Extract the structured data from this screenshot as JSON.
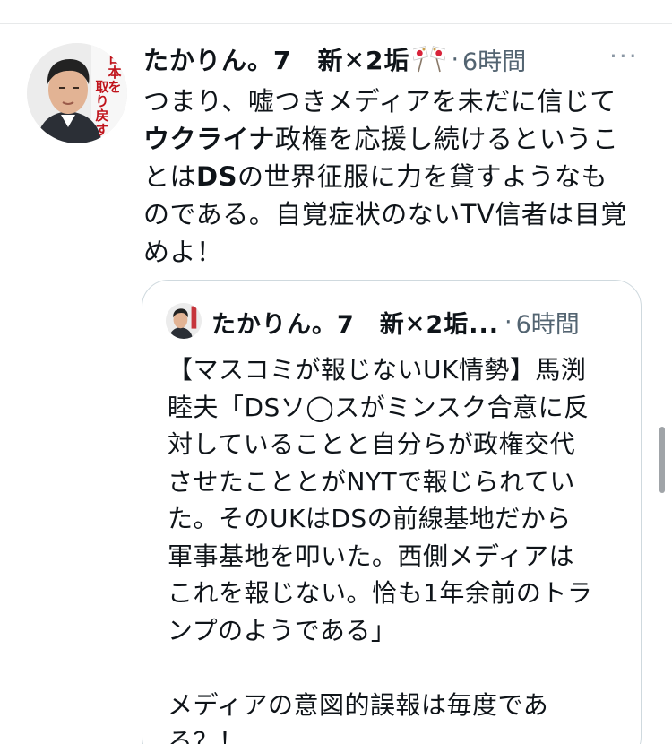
{
  "tweet": {
    "author_name": "たかりん。7　新✕2垢",
    "timestamp": "6時間",
    "more_label": "···",
    "text_lines": [
      "つまり、嘘つきメディアを未だに信じて",
      "ウクライナ政権を応援し続けるというこ",
      "とはDSの世界征服に力を貸すようなも",
      "のである。自覚症状のないTV信者は目覚",
      "めよ！"
    ],
    "avatar_text": "日本を、取り戻す。"
  },
  "quote": {
    "author_name": "たかりん。7　新✕2垢...",
    "timestamp": "6時間",
    "text_lines": [
      "【マスコミが報じないUK情勢】馬渕",
      "睦夫「DSソ◯スがミンスク合意に反",
      "対していることと自分らが政権交代",
      "させたこととがNYTで報じられてい",
      "た。そのUKはDSの前線基地だから",
      "軍事基地を叩いた。西側メディアは",
      "これを報じない。恰も1年余前のトラ",
      "ンプのようである」",
      "",
      "メディアの意図的誤報は毎度であ",
      "る？！"
    ]
  },
  "colors": {
    "text": "#0f1419",
    "secondary": "#536471",
    "border": "#cfd9de",
    "flag_red": "#d8233a"
  },
  "icons": {
    "flags": "crossed-japan-flags-icon",
    "more": "more-dots-icon"
  }
}
